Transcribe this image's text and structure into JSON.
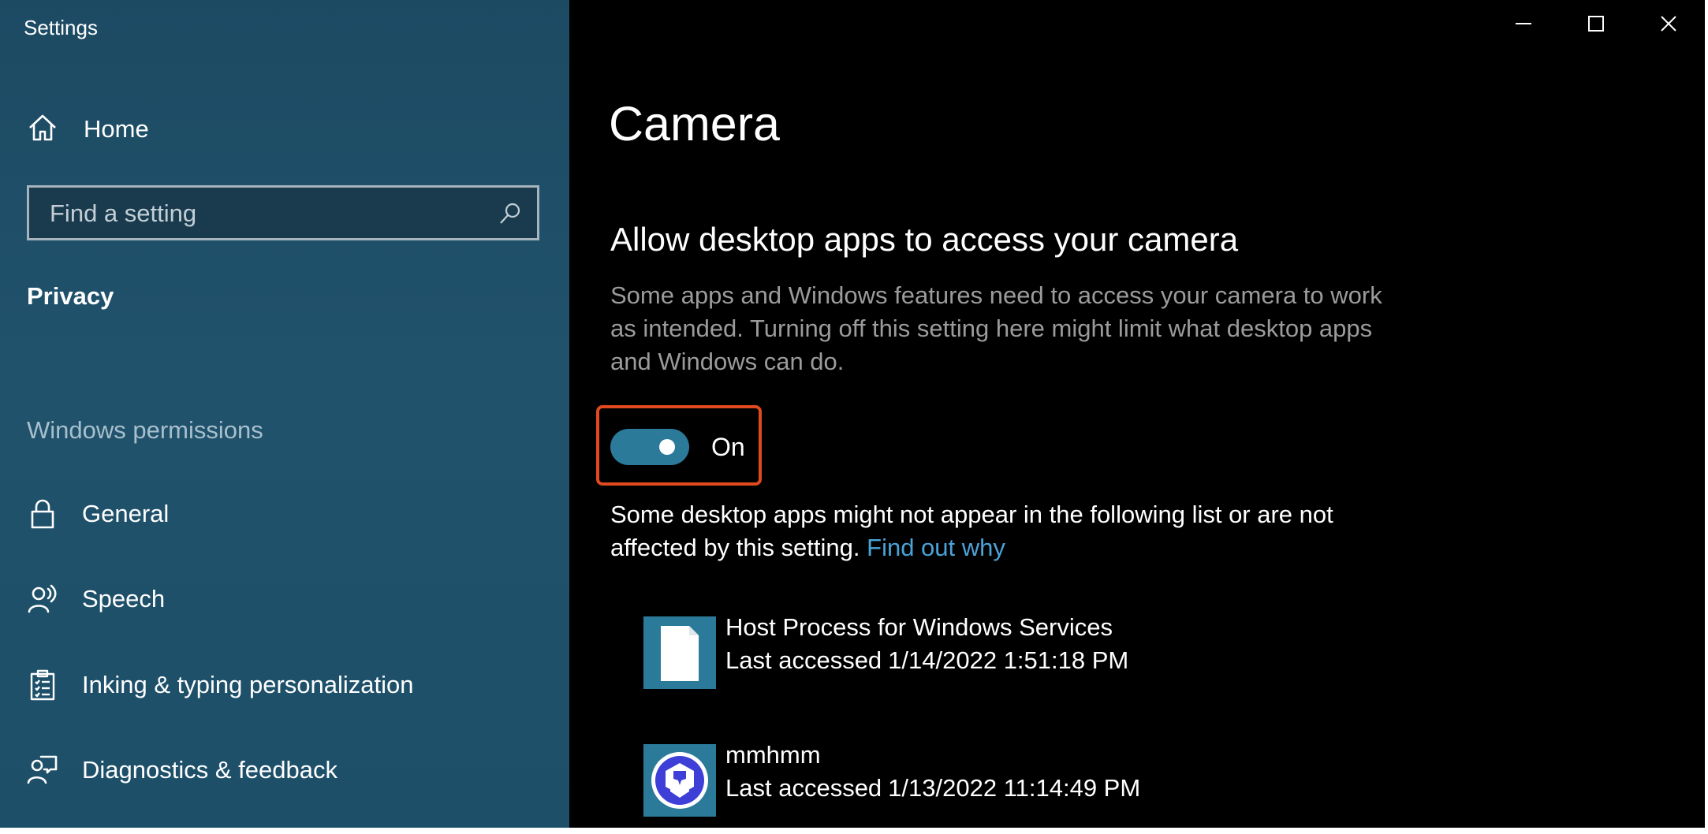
{
  "window": {
    "title": "Settings",
    "controls": {
      "minimize": "minimize-icon",
      "maximize": "maximize-icon",
      "close": "close-icon"
    }
  },
  "sidebar": {
    "home_label": "Home",
    "search_placeholder": "Find a setting",
    "search_value": "",
    "section_title": "Privacy",
    "group_title": "Windows permissions",
    "items": [
      {
        "label": "General",
        "icon": "lock-icon"
      },
      {
        "label": "Speech",
        "icon": "speech-icon"
      },
      {
        "label": "Inking & typing personalization",
        "icon": "clipboard-icon"
      },
      {
        "label": "Diagnostics & feedback",
        "icon": "feedback-icon"
      }
    ],
    "background_color": "#1d4a63"
  },
  "main": {
    "page_title": "Camera",
    "section_title": "Allow desktop apps to access your camera",
    "section_description": "Some apps and Windows features need to access your camera to work as intended. Turning off this setting here might limit what desktop apps and Windows can do.",
    "toggle": {
      "state_label": "On",
      "checked": true,
      "color": "#2b7a9a"
    },
    "note_text": "Some desktop apps might not appear in the following list or are not affected by this setting.",
    "note_link": "Find out why",
    "link_color": "#4aa3d8",
    "highlight_color": "#e04a1e",
    "apps": [
      {
        "name": "Host Process for Windows Services",
        "last_accessed_label": "Last accessed",
        "last_accessed": "1/14/2022 1:51:18 PM",
        "icon": "document-icon"
      },
      {
        "name": "mmhmm",
        "last_accessed_label": "Last accessed",
        "last_accessed": "1/13/2022 11:14:49 PM",
        "icon": "mmhmm-logo-icon"
      }
    ]
  }
}
